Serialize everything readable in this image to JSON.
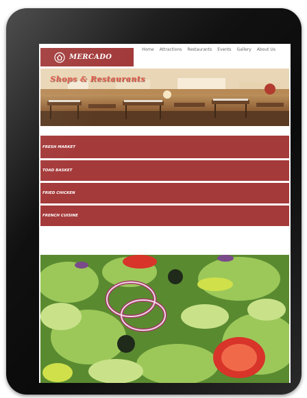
{
  "brand": {
    "name": "MERCADO",
    "icon": "house-icon",
    "color": "#a23a3a"
  },
  "nav": {
    "items": [
      "Home",
      "Attractions",
      "Restaurants",
      "Events",
      "Gallery",
      "About Us"
    ]
  },
  "banner": {
    "title": "Shops & Restaurants"
  },
  "menu": {
    "items": [
      "FRESH MARKET",
      "TOAD BASKET",
      "FRIED CHICKEN",
      "FRENCH CUISINE"
    ],
    "color": "#a53a3a"
  },
  "image": {
    "subject": "salad-photo"
  }
}
